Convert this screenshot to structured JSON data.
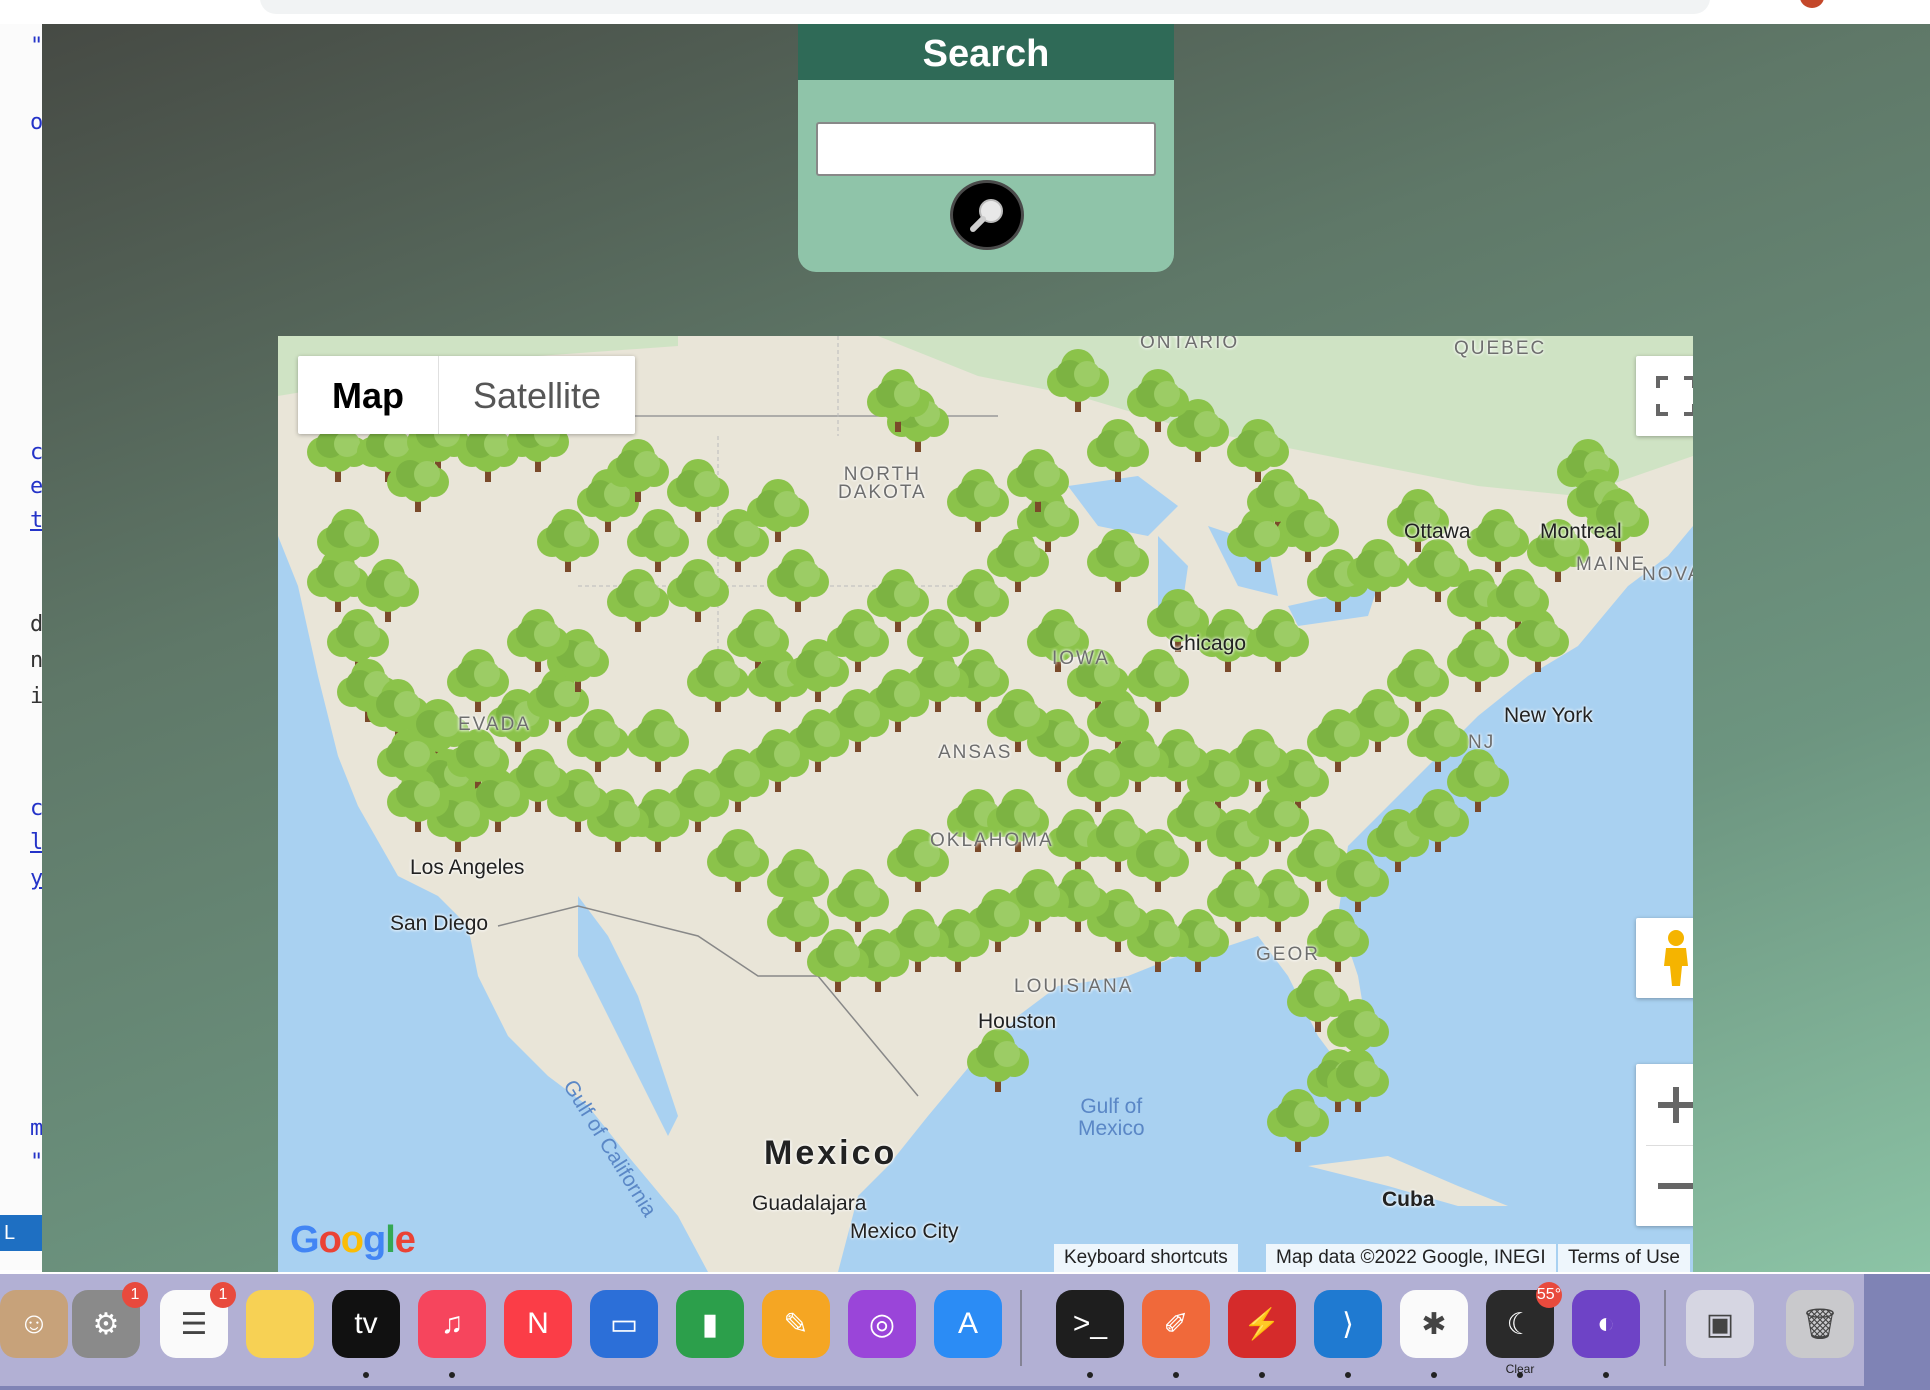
{
  "search": {
    "title": "Search",
    "input_value": ""
  },
  "map": {
    "type_buttons": [
      "Map",
      "Satellite"
    ],
    "active_type": "Map",
    "labels": {
      "ontario": "ONTARIO",
      "quebec": "QUEBEC",
      "north_dakota": "NORTH\nDAKOTA",
      "ottawa": "Ottawa",
      "montreal": "Montreal",
      "maine": "MAINE",
      "nova": "NOVA",
      "chicago": "Chicago",
      "iowa": "IOWA",
      "new_york": "New York",
      "nj": "NJ",
      "nevada": "EVADA",
      "kansas": "ANSAS",
      "oklahoma": "OKLAHOMA",
      "los_angeles": "Los Angeles",
      "san_diego": "San Diego",
      "louisiana": "LOUISIANA",
      "houston": "Houston",
      "georgia": "GEOR",
      "gulf_california": "Gulf of California",
      "gulf_mexico": "Gulf of\nMexico",
      "mexico": "Mexico",
      "guadalajara": "Guadalajara",
      "mexico_city": "Mexico City",
      "cuba": "Cuba"
    },
    "attribution": {
      "keyboard": "Keyboard shortcuts",
      "data": "Map data ©2022 Google, INEGI",
      "terms": "Terms of Use"
    },
    "google_logo": "Google",
    "marker_icon": "tree-icon",
    "colors": {
      "water": "#a9d1f1",
      "land": "#e9e5d8",
      "tree": "#8bc34a",
      "trunk": "#7a4a2a"
    }
  },
  "dock": {
    "apps": [
      {
        "name": "contacts",
        "badge": ""
      },
      {
        "name": "system-preferences",
        "badge": "1"
      },
      {
        "name": "reminders",
        "badge": "1"
      },
      {
        "name": "notes",
        "badge": ""
      },
      {
        "name": "apple-tv",
        "badge": "",
        "label": "tv"
      },
      {
        "name": "music",
        "badge": ""
      },
      {
        "name": "news",
        "badge": ""
      },
      {
        "name": "keynote",
        "badge": ""
      },
      {
        "name": "numbers",
        "badge": ""
      },
      {
        "name": "pages",
        "badge": ""
      },
      {
        "name": "podcasts",
        "badge": ""
      },
      {
        "name": "app-store",
        "badge": ""
      },
      {
        "name": "terminal",
        "badge": ""
      },
      {
        "name": "postman",
        "badge": ""
      },
      {
        "name": "bitdefender",
        "badge": ""
      },
      {
        "name": "vscode",
        "badge": ""
      },
      {
        "name": "slack",
        "badge": ""
      },
      {
        "name": "weather",
        "badge": "55°",
        "caption": "Clear"
      },
      {
        "name": "github-desktop",
        "badge": ""
      },
      {
        "name": "screenshot-preview",
        "badge": ""
      },
      {
        "name": "trash",
        "badge": ""
      }
    ]
  },
  "editor_fragments": [
    "o",
    "\"",
    "o",
    "c",
    "e",
    "t",
    "d",
    "n",
    "i",
    "c",
    "l",
    "y",
    "m",
    "\""
  ],
  "status_fragment": "L"
}
